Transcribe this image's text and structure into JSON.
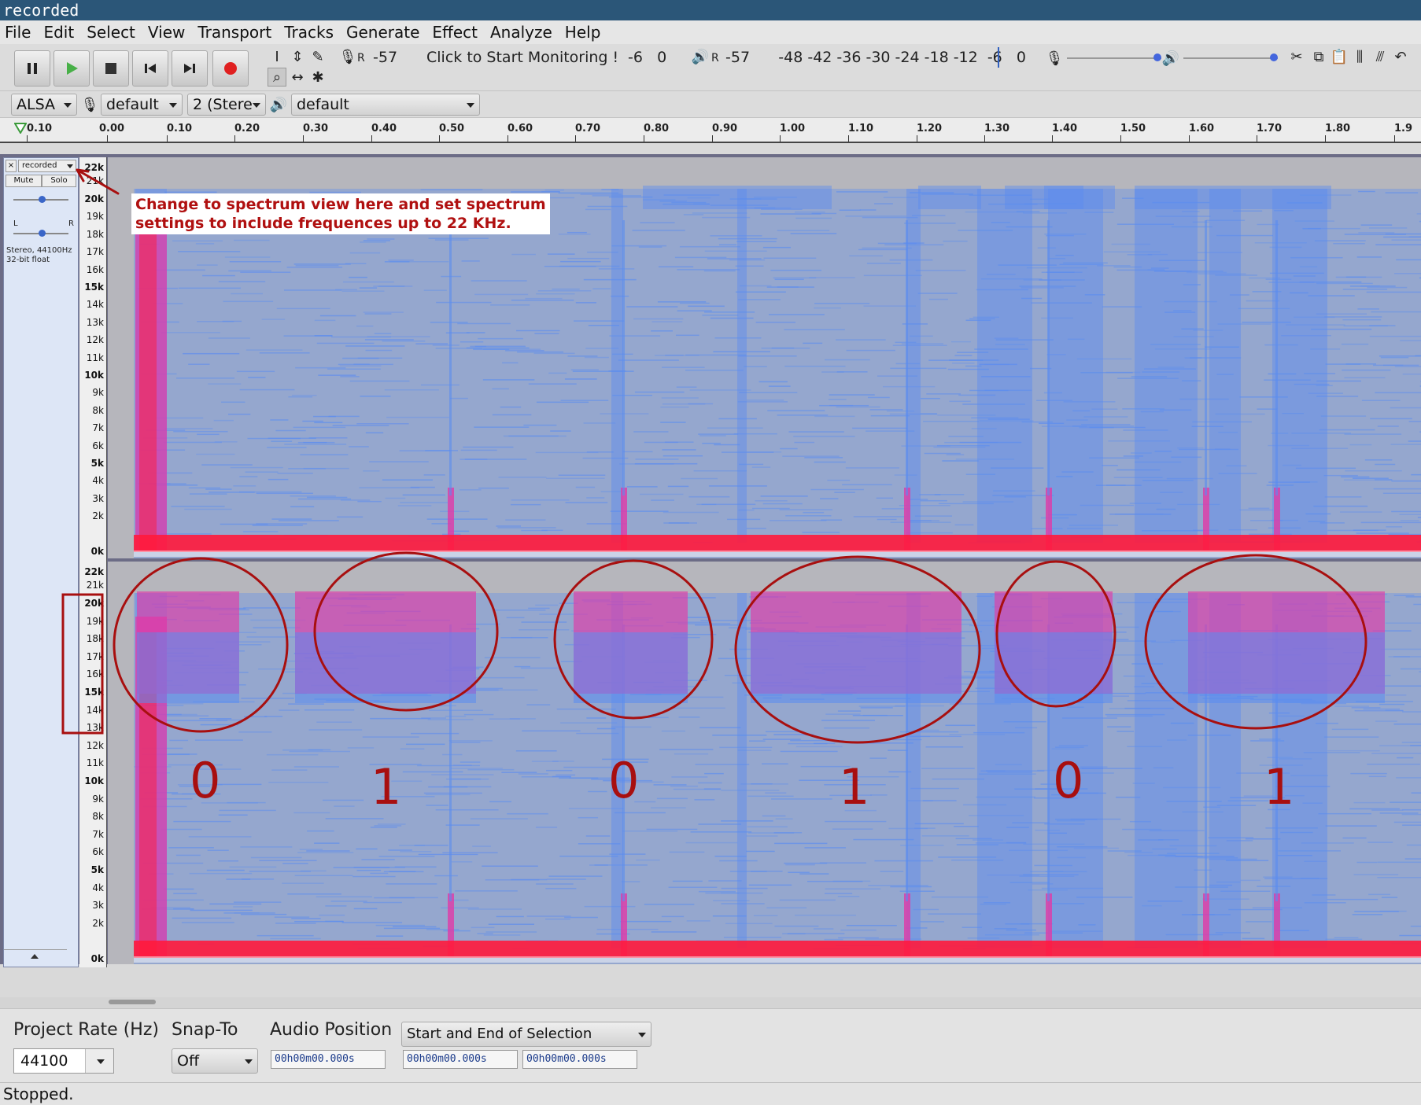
{
  "window": {
    "title": "recorded"
  },
  "menu": [
    "File",
    "Edit",
    "Select",
    "View",
    "Transport",
    "Tracks",
    "Generate",
    "Effect",
    "Analyze",
    "Help"
  ],
  "transport": {
    "pause": "pause-icon",
    "play": "play-icon",
    "stop": "stop-icon",
    "skip_start": "skip-start-icon",
    "skip_end": "skip-end-icon",
    "record": "record-icon"
  },
  "meters": {
    "record_channel_label": "R",
    "record_scale_left": "-57",
    "record_prompt": "Click to Start Monitoring !",
    "record_scale_right": "-6   0",
    "playback_channel_label": "R",
    "playback_scale": "-57      -48 -42 -36 -30 -24 -18 -12  -6   0"
  },
  "device": {
    "host": "ALSA",
    "recording_device": "default",
    "channels": "2 (Stere",
    "playback_device": "default"
  },
  "ruler": {
    "labels": [
      "0.10",
      "0.00",
      "0.10",
      "0.20",
      "0.30",
      "0.40",
      "0.50",
      "0.60",
      "0.70",
      "0.80",
      "0.90",
      "1.00",
      "1.10",
      "1.20",
      "1.30",
      "1.40",
      "1.50",
      "1.60",
      "1.70",
      "1.80",
      "1.9"
    ]
  },
  "track": {
    "name": "recorded",
    "mute": "Mute",
    "solo": "Solo",
    "pan_left": "L",
    "pan_right": "R",
    "info_line1": "Stereo, 44100Hz",
    "info_line2": "32-bit float",
    "close": "×"
  },
  "freq_labels": [
    "22k",
    "21k",
    "20k",
    "19k",
    "18k",
    "17k",
    "16k",
    "15k",
    "14k",
    "13k",
    "12k",
    "11k",
    "10k",
    "9k",
    "8k",
    "7k",
    "6k",
    "5k",
    "4k",
    "3k",
    "2k",
    "0k"
  ],
  "annotation": {
    "text": "Change to spectrum view here and set spectrum\nsettings to include frequences up to 22 KHz."
  },
  "handwritten_digits": [
    "0",
    "1",
    "0",
    "1",
    "0",
    "1"
  ],
  "selection_toolbar": {
    "project_rate_label": "Project Rate (Hz)",
    "project_rate_value": "44100",
    "snap_to_label": "Snap-To",
    "snap_to_value": "Off",
    "audio_position_label": "Audio Position",
    "selection_mode": "Start and End of Selection",
    "time_audio_position": "00h00m00.000s",
    "time_start": "00h00m00.000s",
    "time_end": "00h00m00.000s"
  },
  "status": {
    "text": "Stopped."
  },
  "colors": {
    "titlebar": "#2b5678",
    "spectrogram_bg": "#b6b6bc",
    "spectrogram_blue": "#5a8cf0",
    "spectrogram_magenta": "#e03aa8",
    "spectrogram_red": "#ff1a3c",
    "annotation_red": "#b01010"
  }
}
